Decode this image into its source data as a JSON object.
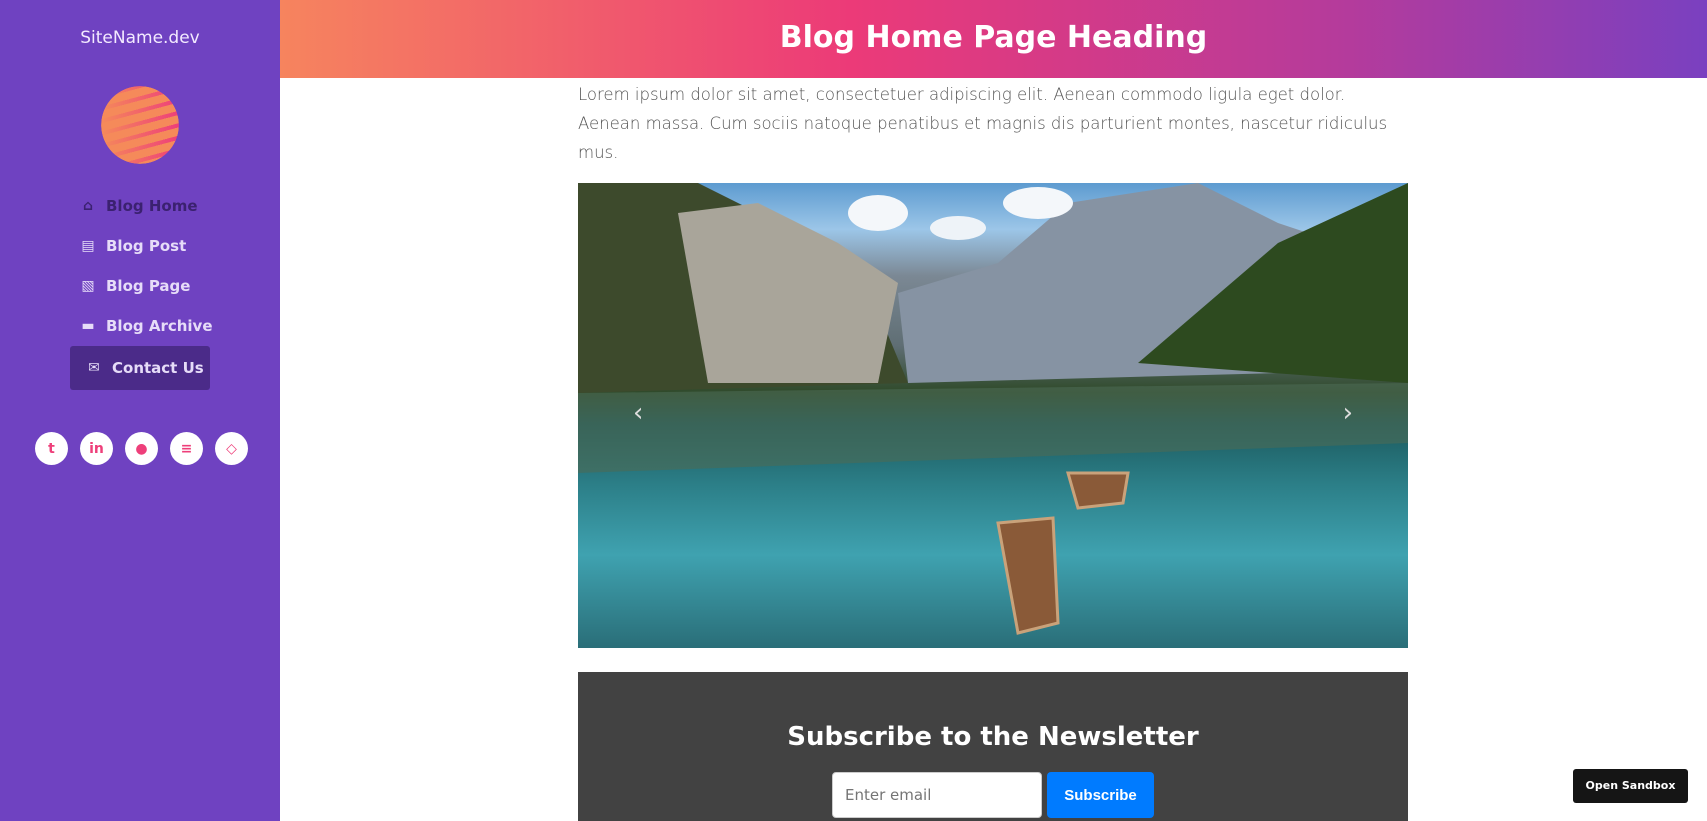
{
  "sidebar": {
    "site_name": "SiteName.dev",
    "items": [
      {
        "label": "Blog Home",
        "icon": "home-icon"
      },
      {
        "label": "Blog Post",
        "icon": "file-icon"
      },
      {
        "label": "Blog Page",
        "icon": "file-image-icon"
      },
      {
        "label": "Blog Archive",
        "icon": "archive-icon"
      },
      {
        "label": "Contact Us",
        "icon": "envelope-icon"
      }
    ],
    "social": [
      "twitter-icon",
      "linkedin-icon",
      "github-icon",
      "stackoverflow-icon",
      "codepen-icon"
    ]
  },
  "header": {
    "title": "Blog Home Page Heading"
  },
  "main": {
    "lead": "Lorem ipsum dolor sit amet, consectetuer adipiscing elit. Aenean commodo ligula eget dolor. Aenean massa. Cum sociis natoque penatibus et magnis dis parturient montes, nascetur ridiculus mus."
  },
  "newsletter": {
    "title": "Subscribe to the Newsletter",
    "placeholder": "Enter email",
    "button": "Subscribe"
  },
  "sandbox": {
    "label": "Open Sandbox"
  }
}
